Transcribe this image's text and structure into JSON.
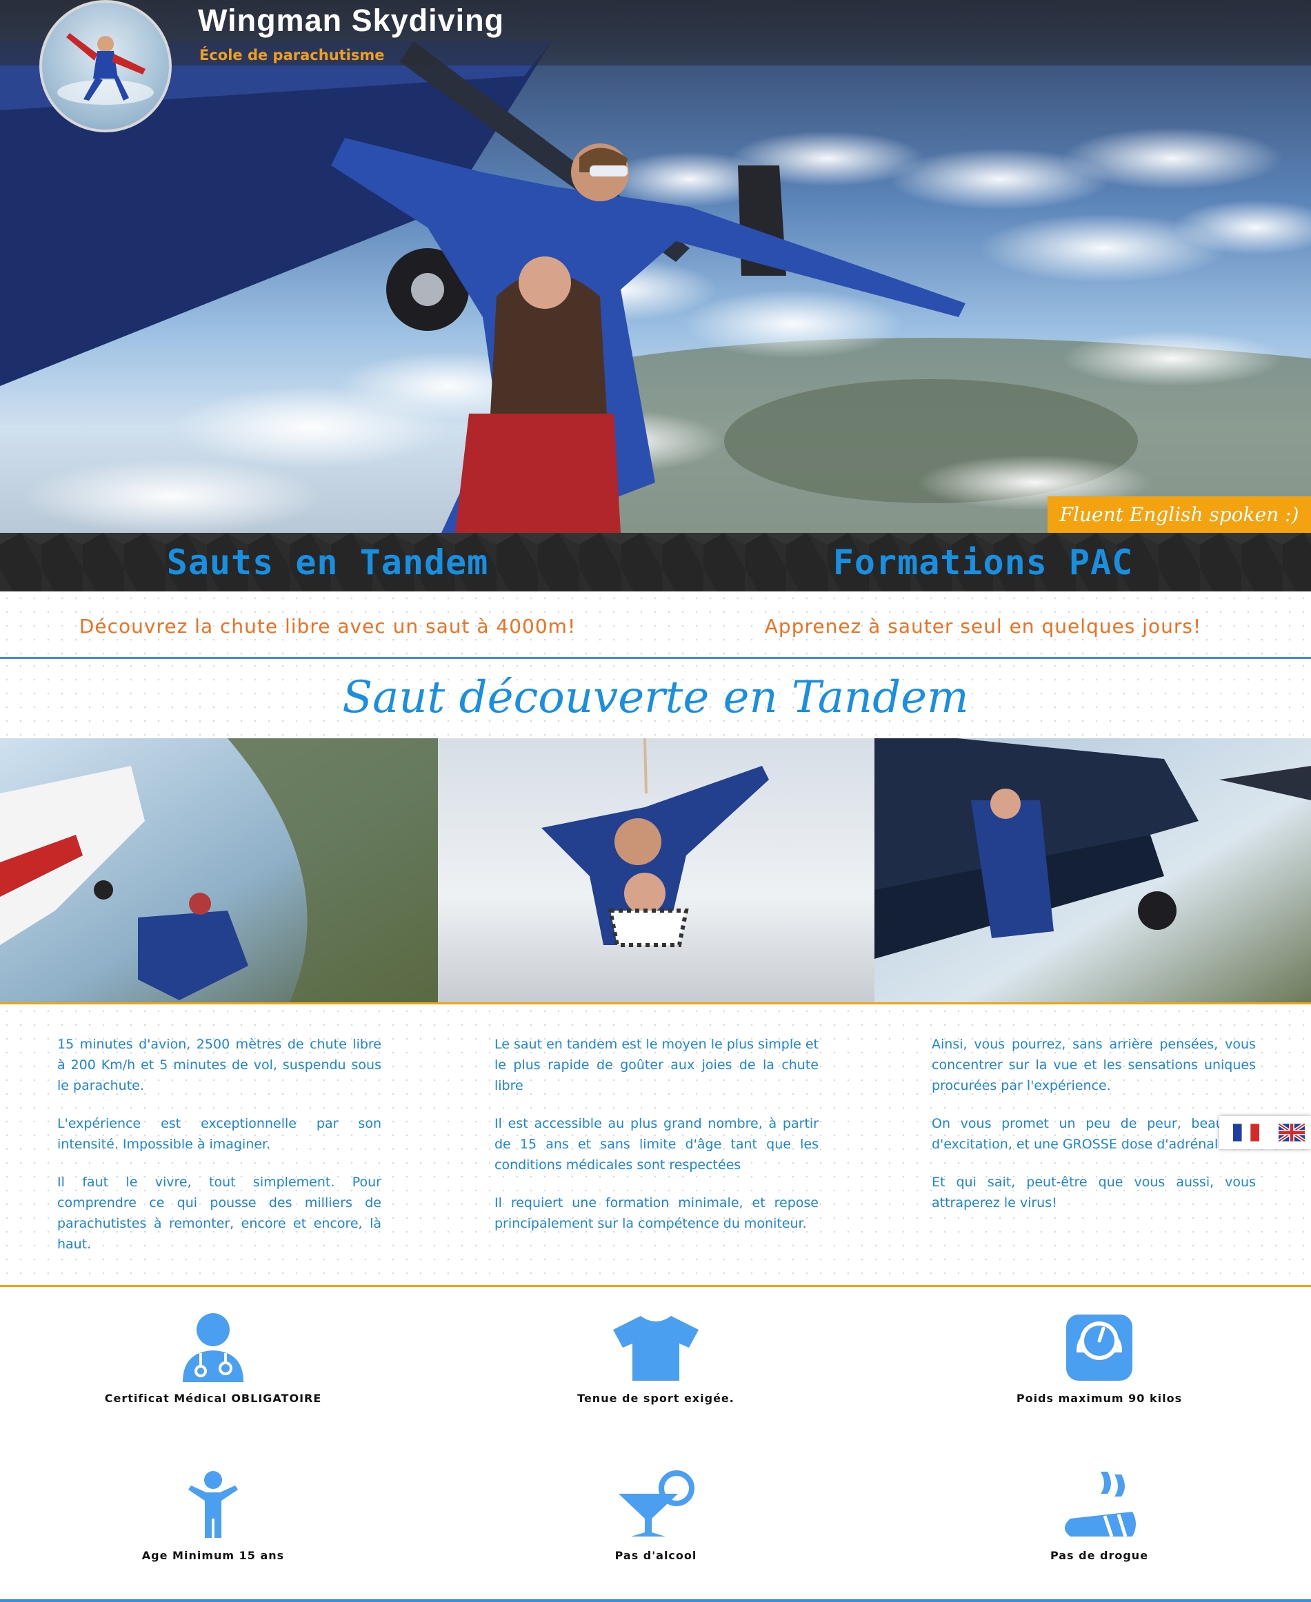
{
  "header": {
    "site_title": "Wingman Skydiving",
    "site_subtitle": "École de parachutisme",
    "fluent_badge": "Fluent English spoken :)"
  },
  "features": [
    {
      "title": "Sauts en Tandem",
      "tagline": "Découvrez la chute libre avec un saut à 4000m!"
    },
    {
      "title": "Formations PAC",
      "tagline": "Apprenez à sauter seul en quelques jours!"
    }
  ],
  "section": {
    "title": "Saut découverte en Tandem"
  },
  "columns": [
    [
      "15 minutes d'avion, 2500 mètres de chute libre à 200 Km/h et 5 minutes de vol, suspendu sous le parachute.",
      "L'expérience est exceptionnelle par son intensité. Impossible à imaginer.",
      "Il faut le vivre, tout simplement. Pour comprendre ce qui pousse des milliers de parachutistes à remonter, encore et encore, là haut."
    ],
    [
      "Le saut en tandem est le moyen le plus simple et le plus rapide de goûter aux joies de la chute libre",
      "Il est accessible au plus grand nombre, à partir de 15 ans et sans limite d'âge tant que les conditions médicales sont respectées",
      "Il requiert une formation minimale, et repose principalement sur la compétence du moniteur."
    ],
    [
      "Ainsi, vous pourrez, sans arrière pensées, vous concentrer sur la vue et les sensations uniques procurées par l'expérience.",
      "On vous promet un peu de peur, beaucoup d'excitation, et une GROSSE dose d'adrénaline",
      "Et qui sait, peut-être que vous aussi, vous attraperez le virus!"
    ]
  ],
  "requirements": [
    {
      "icon": "doctor-icon",
      "label": "Certificat Médical OBLIGATOIRE"
    },
    {
      "icon": "tshirt-icon",
      "label": "Tenue de sport exigée."
    },
    {
      "icon": "scale-icon",
      "label": "Poids maximum 90 kilos"
    },
    {
      "icon": "child-icon",
      "label": "Age Minimum 15 ans"
    },
    {
      "icon": "cocktail-icon",
      "label": "Pas d'alcool"
    },
    {
      "icon": "no-drugs-icon",
      "label": "Pas de drogue"
    }
  ],
  "colors": {
    "accent_blue": "#1a8fe0",
    "accent_orange": "#f07020",
    "badge_orange": "#f2a30f",
    "icon_blue": "#4a9ff0"
  },
  "language_flags": [
    "fr-flag-icon",
    "en-flag-icon"
  ]
}
